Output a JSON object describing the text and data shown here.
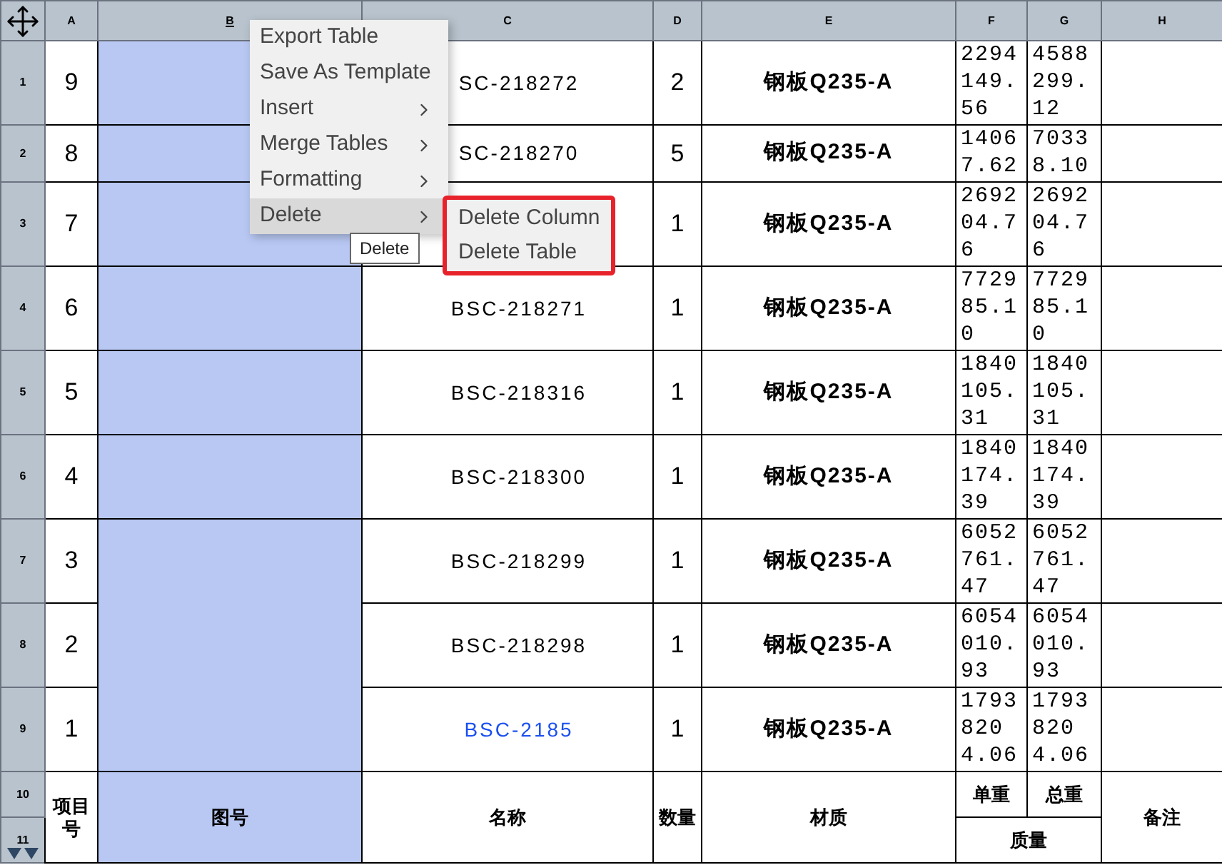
{
  "columns": [
    {
      "label": "A",
      "selected": false
    },
    {
      "label": "B",
      "selected": true
    },
    {
      "label": "C",
      "selected": false
    },
    {
      "label": "D",
      "selected": false
    },
    {
      "label": "E",
      "selected": false
    },
    {
      "label": "F",
      "selected": false
    },
    {
      "label": "G",
      "selected": false
    },
    {
      "label": "H",
      "selected": false
    }
  ],
  "rows": [
    {
      "num": "1",
      "item": "9",
      "name": "SC-218272",
      "kind": "text",
      "qty": "2",
      "material": "钢板Q235-A",
      "unit_weight": "2294149.56",
      "total_weight": "4588299.12"
    },
    {
      "num": "2",
      "item": "8",
      "name": "SC-218270",
      "kind": "text",
      "qty": "5",
      "material": "钢板Q235-A",
      "unit_weight": "14067.62",
      "total_weight": "70338.10"
    },
    {
      "num": "3",
      "item": "7",
      "kind": "text",
      "qty": "1",
      "material": "钢板Q235-A",
      "unit_weight": "269204.76",
      "total_weight": "269204.76"
    },
    {
      "num": "4",
      "item": "6",
      "name": "BSC-218271",
      "kind": "text",
      "qty": "1",
      "material": "钢板Q235-A",
      "unit_weight": "772985.10",
      "total_weight": "772985.10"
    },
    {
      "num": "5",
      "item": "5",
      "name": "BSC-218316",
      "kind": "text",
      "qty": "1",
      "material": "钢板Q235-A",
      "unit_weight": "1840105.31",
      "total_weight": "1840105.31"
    },
    {
      "num": "6",
      "item": "4",
      "name": "BSC-218300",
      "kind": "text",
      "qty": "1",
      "material": "钢板Q235-A",
      "unit_weight": "1840174.39",
      "total_weight": "1840174.39"
    },
    {
      "num": "7",
      "item": "3",
      "name": "BSC-218299",
      "kind": "text",
      "qty": "1",
      "material": "钢板Q235-A",
      "unit_weight": "6052761.47",
      "total_weight": "6052761.47"
    },
    {
      "num": "8",
      "item": "2",
      "name": "BSC-218298",
      "kind": "text",
      "qty": "1",
      "material": "钢板Q235-A",
      "unit_weight": "6054010.93",
      "total_weight": "6054010.93",
      "drawing_no_merged": true
    },
    {
      "num": "9",
      "item": "1",
      "name": "BSC-2185",
      "kind": "link",
      "qty": "1",
      "material": "钢板Q235-A",
      "unit_weight": "17938204.06",
      "total_weight": "17938204.06",
      "drawing_no_merged": true
    }
  ],
  "footer": {
    "row_numbers": [
      "10",
      "11"
    ],
    "item": "项目号",
    "drawing_no": "图号",
    "name": "名称",
    "qty": "数量",
    "material": "材质",
    "unit_weight": "单重",
    "total_weight": "总重",
    "weight": "质量",
    "remarks": "备注"
  },
  "context_menu": {
    "items": [
      {
        "label": "Export Table",
        "has_submenu": false,
        "selected": false
      },
      {
        "label": "Save As Template",
        "has_submenu": false,
        "selected": false
      },
      {
        "label": "Insert",
        "has_submenu": true,
        "selected": false
      },
      {
        "label": "Merge Tables",
        "has_submenu": true,
        "selected": false
      },
      {
        "label": "Formatting",
        "has_submenu": true,
        "selected": false
      },
      {
        "label": "Delete",
        "has_submenu": true,
        "selected": true
      }
    ],
    "submenu": [
      "Delete Column",
      "Delete Table"
    ],
    "tooltip": "Delete"
  }
}
